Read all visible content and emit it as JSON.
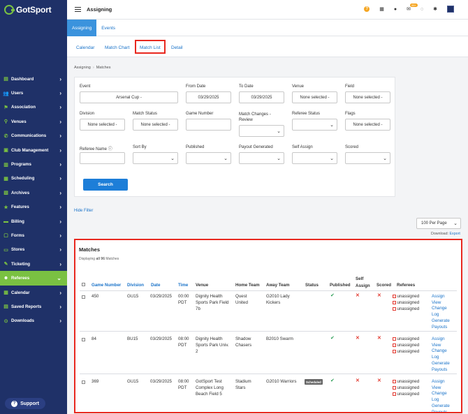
{
  "app": {
    "logo_text": "GotSport"
  },
  "header": {
    "title": "Assigning",
    "mail_badge": "99+"
  },
  "sidebar": {
    "items": [
      {
        "label": "Dashboard",
        "icon": "dashboard-icon"
      },
      {
        "label": "Users",
        "icon": "users-icon"
      },
      {
        "label": "Association",
        "icon": "association-icon"
      },
      {
        "label": "Venues",
        "icon": "venues-icon"
      },
      {
        "label": "Communications",
        "icon": "communications-icon"
      },
      {
        "label": "Club Management",
        "icon": "club-icon"
      },
      {
        "label": "Programs",
        "icon": "programs-icon"
      },
      {
        "label": "Scheduling",
        "icon": "scheduling-icon"
      },
      {
        "label": "Archives",
        "icon": "archives-icon"
      },
      {
        "label": "Features",
        "icon": "features-icon"
      },
      {
        "label": "Billing",
        "icon": "billing-icon"
      },
      {
        "label": "Forms",
        "icon": "forms-icon"
      },
      {
        "label": "Stores",
        "icon": "stores-icon"
      },
      {
        "label": "Ticketing",
        "icon": "ticketing-icon"
      },
      {
        "label": "Referees",
        "icon": "referees-icon",
        "active": true
      },
      {
        "label": "Calendar",
        "icon": "calendar-icon"
      },
      {
        "label": "Saved Reports",
        "icon": "reports-icon"
      },
      {
        "label": "Downloads",
        "icon": "downloads-icon"
      }
    ],
    "support_label": "Support"
  },
  "tabs_primary": [
    "Assigning",
    "Events"
  ],
  "tabs_secondary": [
    "Calendar",
    "Match Chart",
    "Match List",
    "Detail"
  ],
  "breadcrumb": [
    "Assigning",
    "Matches"
  ],
  "filters": {
    "event": {
      "label": "Event",
      "value": "Arsenal Cup -"
    },
    "from_date": {
      "label": "From Date",
      "value": "03/29/2025"
    },
    "to_date": {
      "label": "To Date",
      "value": "03/29/2025"
    },
    "venue": {
      "label": "Venue",
      "value": "None selected -"
    },
    "field": {
      "label": "Field",
      "value": "None selected -"
    },
    "division": {
      "label": "Division",
      "value": "None selected -"
    },
    "match_status": {
      "label": "Match Status",
      "value": "None selected -"
    },
    "game_number": {
      "label": "Game Number",
      "value": ""
    },
    "match_changes": {
      "label": "Match Changes - Review",
      "value": ""
    },
    "referee_status": {
      "label": "Referee Status",
      "value": ""
    },
    "flags": {
      "label": "Flags",
      "value": "None selected -"
    },
    "referee_name": {
      "label": "Referee Name",
      "value": ""
    },
    "sort_by": {
      "label": "Sort By",
      "value": ""
    },
    "published": {
      "label": "Published",
      "value": ""
    },
    "payout_generated": {
      "label": "Payout Generated",
      "value": ""
    },
    "self_assign": {
      "label": "Self Assign",
      "value": ""
    },
    "scored": {
      "label": "Scored",
      "value": ""
    },
    "search_label": "Search"
  },
  "hide_filter": "Hide Filter",
  "per_page": "100 Per Page",
  "download": {
    "label": "Download:",
    "link": "Export"
  },
  "matches": {
    "title": "Matches",
    "displaying_prefix": "Displaying",
    "displaying_all": "all 96",
    "displaying_suffix": "Matches",
    "columns": [
      "Game Number",
      "Division",
      "Date",
      "Time",
      "Venue",
      "Home Team",
      "Away Team",
      "Status",
      "Published",
      "Self Assign",
      "Scored",
      "Referees"
    ],
    "rows": [
      {
        "game": "450",
        "division": "GU15",
        "date": "03/29/2025",
        "time1": "00:00",
        "time2": "PDT",
        "venue": [
          "Dignity Health",
          "Sports Park Field",
          "7b"
        ],
        "home": [
          "Quest",
          "United"
        ],
        "away": [
          "G2010 Lady",
          "Kickers"
        ],
        "status": "",
        "referees": [
          "unassigned",
          "unassigned",
          "unassigned"
        ],
        "actions": [
          "Assign",
          "View",
          "Change",
          "Log",
          "Generate",
          "Payouts"
        ]
      },
      {
        "game": "84",
        "division": "BU15",
        "date": "03/29/2025",
        "time1": "08:00",
        "time2": "PDT",
        "venue": [
          "Dignity Health",
          "Sports Park Univ.",
          "2"
        ],
        "home": [
          "Shadow",
          "Chasers"
        ],
        "away": [
          "B2010 Swarm"
        ],
        "status": "",
        "referees": [
          "unassigned",
          "unassigned",
          "unassigned"
        ],
        "actions": [
          "Assign",
          "View",
          "Change",
          "Log",
          "Generate",
          "Payouts"
        ]
      },
      {
        "game": "369",
        "division": "GU15",
        "date": "03/29/2025",
        "time1": "08:00",
        "time2": "PDT",
        "venue": [
          "GotSport Test",
          "Complex Long",
          "Beach Field 5"
        ],
        "home": [
          "Stadium",
          "Stars"
        ],
        "away": [
          "G2010 Warriors"
        ],
        "status": "Scheduled",
        "referees": [
          "unassigned",
          "unassigned",
          "unassigned"
        ],
        "actions": [
          "Assign",
          "View",
          "Change",
          "Log",
          "Generate",
          "Payouts"
        ]
      }
    ]
  }
}
